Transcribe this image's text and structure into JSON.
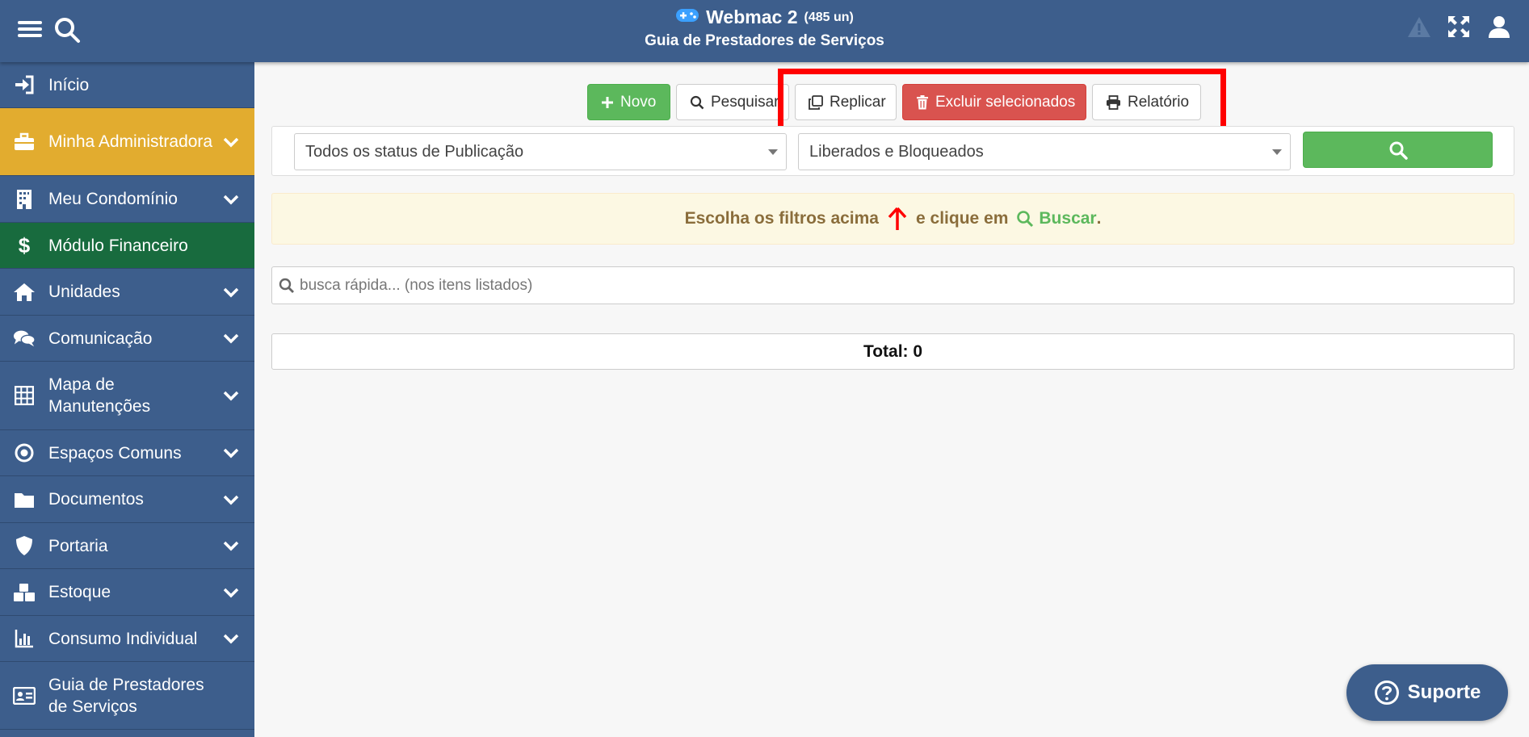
{
  "header": {
    "app_name": "Webmac 2",
    "units": "(485 un)",
    "page_title": "Guia de Prestadores de Serviços"
  },
  "sidebar": {
    "items": [
      {
        "label": "Início",
        "icon": "sign-in-icon"
      },
      {
        "label": "Minha Administradora",
        "icon": "briefcase-icon"
      },
      {
        "label": "Meu Condomínio",
        "icon": "building-icon"
      },
      {
        "label": "Módulo Financeiro",
        "icon": "dollar-icon"
      },
      {
        "label": "Unidades",
        "icon": "home-icon"
      },
      {
        "label": "Comunicação",
        "icon": "comments-icon"
      },
      {
        "label": "Mapa de Manutenções",
        "icon": "grid-icon"
      },
      {
        "label": "Espaços Comuns",
        "icon": "dot-circle-icon"
      },
      {
        "label": "Documentos",
        "icon": "folder-icon"
      },
      {
        "label": "Portaria",
        "icon": "shield-icon"
      },
      {
        "label": "Estoque",
        "icon": "cubes-icon"
      },
      {
        "label": "Consumo Individual",
        "icon": "bar-chart-icon"
      },
      {
        "label": "Guia de Prestadores de Serviços",
        "icon": "id-card-icon"
      }
    ]
  },
  "toolbar": {
    "new_label": "Novo",
    "search_label": "Pesquisar",
    "replicate_label": "Replicar",
    "delete_label": "Excluir selecionados",
    "report_label": "Relatório"
  },
  "filters": {
    "publication_status": "Todos os status de Publicação",
    "release_status": "Liberados e Bloqueados"
  },
  "notice": {
    "text_before": "Escolha os filtros acima",
    "text_middle": "e clique em",
    "action": "Buscar",
    "period": "."
  },
  "quick_search": {
    "placeholder": "busca rápida... (nos itens listados)"
  },
  "total": {
    "label": "Total: 0"
  },
  "support": {
    "label": "Suporte"
  },
  "colors": {
    "header_bg": "#3d5e8c",
    "active_gold": "#e2ac2f",
    "financial_green": "#186b3e",
    "success_green": "#5cb85c",
    "danger_red": "#d9534f",
    "highlight_red": "#ff0000"
  }
}
